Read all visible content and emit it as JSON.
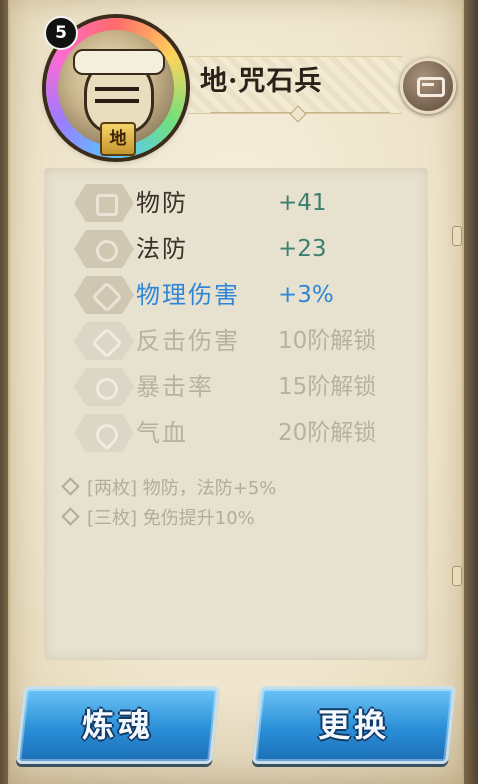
{
  "hero": {
    "level": "5",
    "element": "地",
    "name": "地·咒石兵"
  },
  "stats": [
    {
      "name": "物防",
      "value": "+41",
      "state": "active"
    },
    {
      "name": "法防",
      "value": "+23",
      "state": "active"
    },
    {
      "name": "物理伤害",
      "value": "+3%",
      "state": "highlight"
    },
    {
      "name": "反击伤害",
      "value": "10阶解锁",
      "state": "locked"
    },
    {
      "name": "暴击率",
      "value": "15阶解锁",
      "state": "locked"
    },
    {
      "name": "气血",
      "value": "20阶解锁",
      "state": "locked"
    }
  ],
  "set_bonuses": [
    "[两枚] 物防，法防+5%",
    "[三枚] 免伤提升10%"
  ],
  "buttons": {
    "refine": "炼魂",
    "swap": "更换"
  },
  "colors": {
    "stat_value": "#3d7f6e",
    "highlight": "#2f86d9",
    "locked": "#b8b1a0",
    "button": "#2b8fd8"
  }
}
